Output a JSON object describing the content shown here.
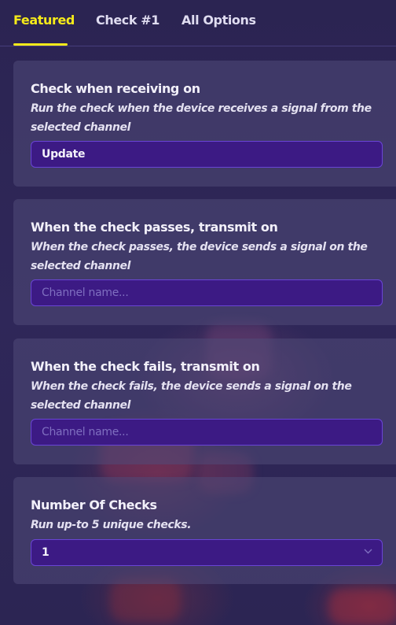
{
  "tabs": [
    {
      "label": "Featured",
      "active": true
    },
    {
      "label": "Check #1",
      "active": false
    },
    {
      "label": "All Options",
      "active": false
    }
  ],
  "sections": [
    {
      "title": "Check when receiving on",
      "description": "Run the check when the device receives a signal from the selected channel",
      "field_value": "Update",
      "field_placeholder": ""
    },
    {
      "title": "When the check passes, transmit on",
      "description": "When the check passes, the device sends a signal on the selected channel",
      "field_value": "",
      "field_placeholder": "Channel name..."
    },
    {
      "title": "When the check fails, transmit on",
      "description": "When the check fails, the device sends a signal on the selected channel",
      "field_value": "",
      "field_placeholder": "Channel name..."
    },
    {
      "title": "Number Of Checks",
      "description": "Run up-to 5 unique checks.",
      "select_value": "1",
      "select_icon": "chevron-down-icon"
    }
  ],
  "colors": {
    "active_tab": "#f5ea1a",
    "field_bg": "#3c1a84",
    "field_border": "#6a45d6"
  }
}
